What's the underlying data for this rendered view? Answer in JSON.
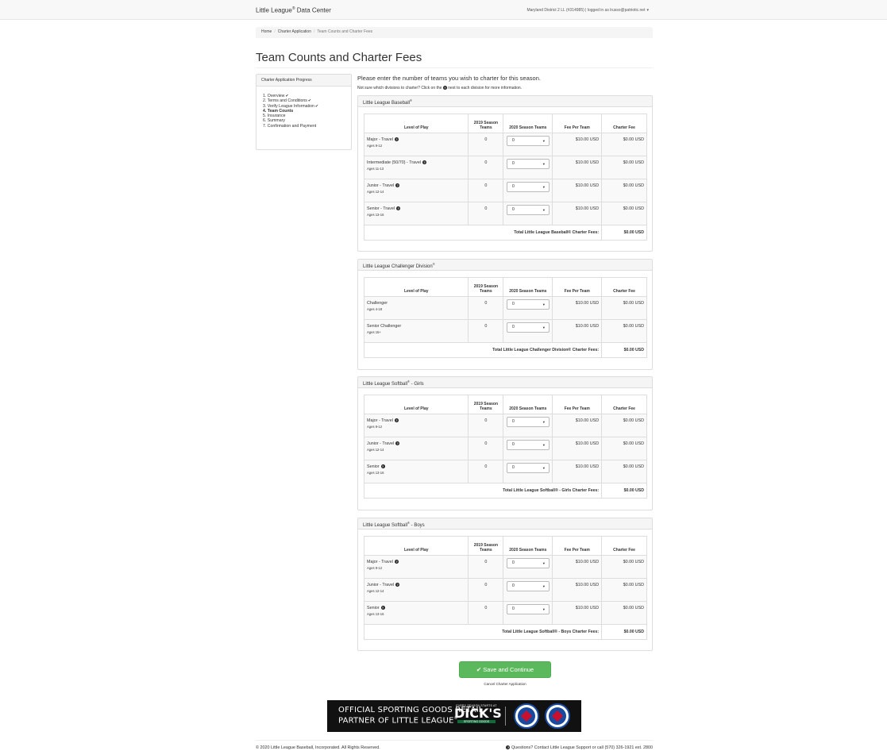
{
  "nav": {
    "brand": "Little League",
    "brand_suffix": "Data Center",
    "user_info": "Maryland District 2 LL (#314985) | logged in as lrusso@patriotic.net"
  },
  "breadcrumb": [
    "Home",
    "Charter Application",
    "Team Counts and Charter Fees"
  ],
  "page_title": "Team Counts and Charter Fees",
  "sidebar": {
    "title": "Charter Application Progress",
    "steps": [
      {
        "label": "1. Overview",
        "done": true
      },
      {
        "label": "2. Terms and Conditions",
        "done": true
      },
      {
        "label": "3. Verify League Information",
        "done": true
      },
      {
        "label": "4. Team Counts",
        "done": false,
        "current": true
      },
      {
        "label": "5. Insurance",
        "done": false
      },
      {
        "label": "6. Summary",
        "done": false
      },
      {
        "label": "7. Confirmation and Payment",
        "done": false
      }
    ]
  },
  "intro": "Please enter the number of teams you wish to charter for this season.",
  "intro_sub_before": "Not sure which divisions to charter? Click on the",
  "intro_sub_after": "next to each division for more information.",
  "columns": {
    "level": "Level of Play",
    "prev": "2019 Season Teams",
    "next": "2020 Season Teams",
    "fee": "Fee Per Team",
    "charter": "Charter Fee"
  },
  "sections": [
    {
      "title": "Little League Baseball",
      "reg": "®",
      "title_suffix": "",
      "total_label": "Total Little League Baseball® Charter Fees:",
      "total_value": "$0.00 USD",
      "rows": [
        {
          "level": "Major - Travel",
          "ages": "Ages 9-12",
          "info": true,
          "prev": "0",
          "next": "0",
          "fee": "$10.00 USD",
          "charter": "$0.00 USD"
        },
        {
          "level": "Intermediate (50/70) - Travel",
          "ages": "Ages 11-13",
          "info": true,
          "prev": "0",
          "next": "0",
          "fee": "$10.00 USD",
          "charter": "$0.00 USD"
        },
        {
          "level": "Junior - Travel",
          "ages": "Ages 12-14",
          "info": true,
          "prev": "0",
          "next": "0",
          "fee": "$10.00 USD",
          "charter": "$0.00 USD"
        },
        {
          "level": "Senior - Travel",
          "ages": "Ages 13-16",
          "info": true,
          "prev": "0",
          "next": "0",
          "fee": "$10.00 USD",
          "charter": "$0.00 USD"
        }
      ]
    },
    {
      "title": "Little League Challenger Division",
      "reg": "®",
      "title_suffix": "",
      "total_label": "Total Little League Challenger Division® Charter Fees:",
      "total_value": "$0.00 USD",
      "rows": [
        {
          "level": "Challenger",
          "ages": "Ages 4-18",
          "info": false,
          "prev": "0",
          "next": "0",
          "fee": "$10.00 USD",
          "charter": "$0.00 USD"
        },
        {
          "level": "Senior Challenger",
          "ages": "Ages 15+",
          "info": false,
          "prev": "0",
          "next": "0",
          "fee": "$10.00 USD",
          "charter": "$0.00 USD"
        }
      ]
    },
    {
      "title": "Little League Softball",
      "reg": "®",
      "title_suffix": " - Girls",
      "total_label": "Total Little League Softball® - Girls Charter Fees:",
      "total_value": "$0.00 USD",
      "rows": [
        {
          "level": "Major - Travel",
          "ages": "Ages 9-12",
          "info": true,
          "prev": "0",
          "next": "0",
          "fee": "$10.00 USD",
          "charter": "$0.00 USD"
        },
        {
          "level": "Junior - Travel",
          "ages": "Ages 12-14",
          "info": true,
          "prev": "0",
          "next": "0",
          "fee": "$10.00 USD",
          "charter": "$0.00 USD"
        },
        {
          "level": "Senior",
          "ages": "Ages 13-16",
          "info": true,
          "prev": "0",
          "next": "0",
          "fee": "$10.00 USD",
          "charter": "$0.00 USD"
        }
      ]
    },
    {
      "title": "Little League Softball",
      "reg": "®",
      "title_suffix": " - Boys",
      "total_label": "Total Little League Softball® - Boys Charter Fees:",
      "total_value": "$0.00 USD",
      "rows": [
        {
          "level": "Major - Travel",
          "ages": "Ages 9-12",
          "info": true,
          "prev": "0",
          "next": "0",
          "fee": "$10.00 USD",
          "charter": "$0.00 USD"
        },
        {
          "level": "Junior - Travel",
          "ages": "Ages 12-14",
          "info": true,
          "prev": "0",
          "next": "0",
          "fee": "$10.00 USD",
          "charter": "$0.00 USD"
        },
        {
          "level": "Senior",
          "ages": "Ages 13-16",
          "info": true,
          "prev": "0",
          "next": "0",
          "fee": "$10.00 USD",
          "charter": "$0.00 USD"
        }
      ]
    }
  ],
  "actions": {
    "save": "Save and Continue",
    "cancel": "Cancel Charter Application"
  },
  "banner": {
    "line1": "OFFICIAL SPORTING GOODS RETAIL",
    "line2": "PARTNER OF LITTLE LEAGUE",
    "dicks_tag": "EVERY SEASON STARTS AT",
    "dicks_logo": "DICK'S",
    "dicks_sub": "SPORTING GOODS"
  },
  "footer": {
    "left": "© 2020 Little League Baseball, Incorporated. All Rights Reserved.",
    "right": "Questions? Contact Little League Support or call (570) 326-1921 ext. 2800"
  },
  "colors": {
    "primary_button": "#5cb85c",
    "panel_header": "#f5f5f5",
    "border": "#dddddd"
  }
}
